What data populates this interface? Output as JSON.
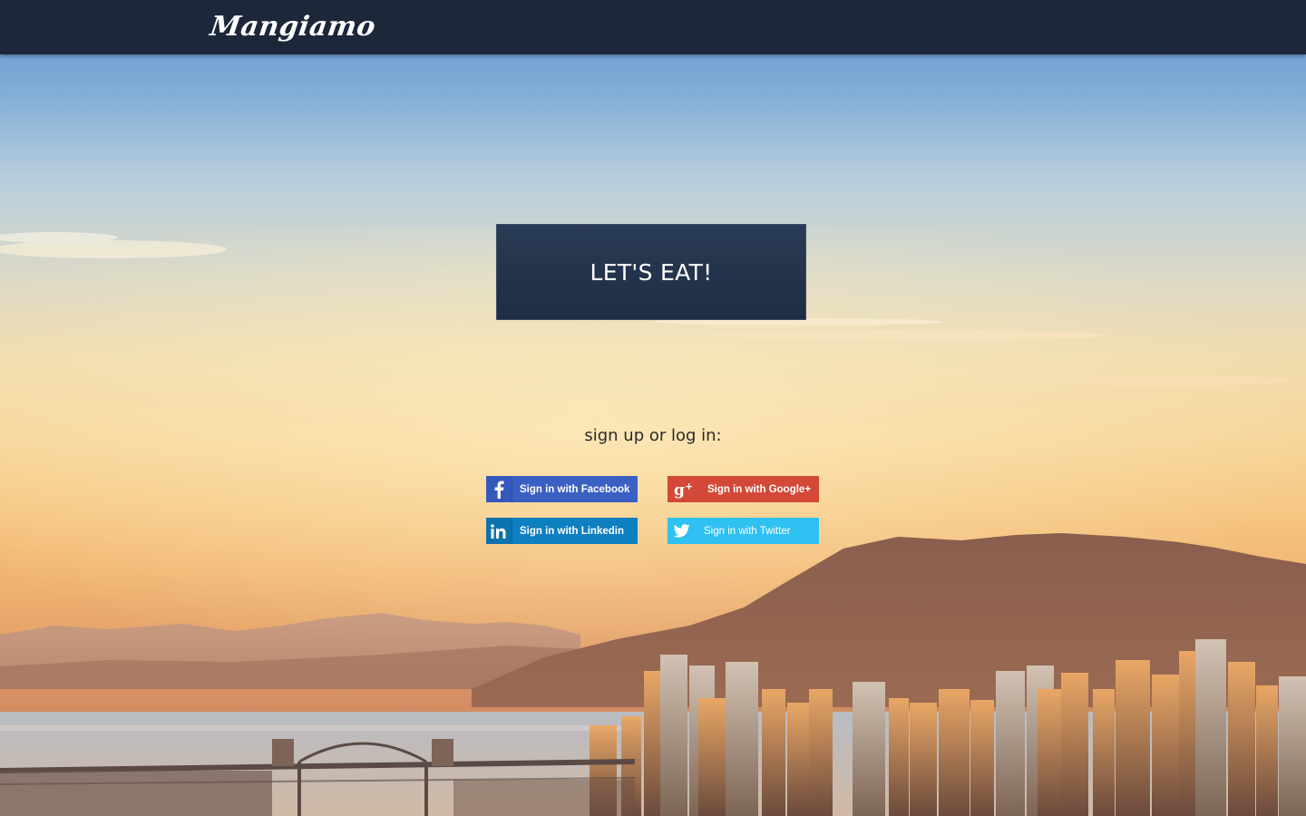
{
  "app": {
    "logo": "Mangiamo"
  },
  "hero": {
    "cta_label": "LET'S EAT!",
    "signup_label": "sign up or log in:"
  },
  "social": {
    "facebook": {
      "label": "Sign in with Facebook",
      "icon": "facebook-icon",
      "color": "#3b5fc2"
    },
    "google": {
      "label": "Sign in with Google+",
      "icon": "google-plus-icon",
      "color": "#d34836"
    },
    "linkedin": {
      "label": "Sign in with Linkedin",
      "icon": "linkedin-icon",
      "color": "#0e7fc0"
    },
    "twitter": {
      "label": "Sign in with Twitter",
      "icon": "twitter-icon",
      "color": "#2fc1f1"
    }
  },
  "theme": {
    "topbar_color": "#1c2739",
    "cta_color": "#23324a"
  }
}
